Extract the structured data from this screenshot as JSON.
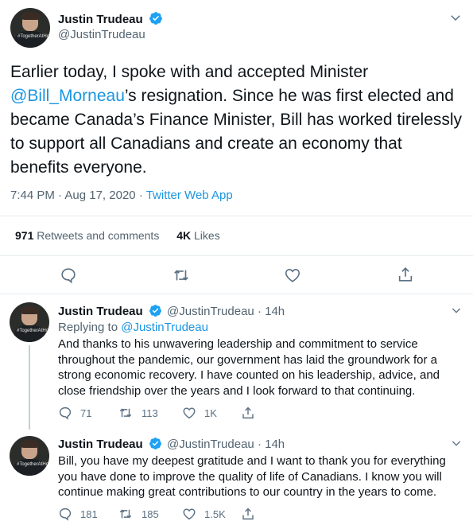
{
  "main_tweet": {
    "author_name": "Justin Trudeau",
    "author_handle": "@JustinTrudeau",
    "avatar_caption": "#TogetherAtHome",
    "text_before": "Earlier today, I spoke with and accepted Minister ",
    "mention": "@Bill_Morneau",
    "text_after": "’s resignation. Since he was first elected and became Canada’s Finance Minister, Bill has worked tirelessly to support all Canadians and create an economy that benefits everyone.",
    "time": "7:44 PM",
    "date": "Aug 17, 2020",
    "separator": "·",
    "source": "Twitter Web App",
    "retweets_count": "971",
    "retweets_label": "Retweets and comments",
    "likes_count": "4K",
    "likes_label": "Likes"
  },
  "replies": [
    {
      "author_name": "Justin Trudeau",
      "author_handle": "@JustinTrudeau",
      "time_ago": "· 14h",
      "replying_to_label": "Replying to",
      "replying_to_handle": "@JustinTrudeau",
      "text": "And thanks to his unwavering leadership and commitment to service throughout the pandemic, our government has laid the groundwork for a strong economic recovery. I have counted on his leadership, advice, and close friendship over the years and I look forward to that continuing.",
      "comments": "71",
      "retweets": "113",
      "likes": "1K"
    },
    {
      "author_name": "Justin Trudeau",
      "author_handle": "@JustinTrudeau",
      "time_ago": "· 14h",
      "text": "Bill, you have my deepest gratitude and I want to thank you for everything you have done to improve the quality of life of Canadians. I know you will continue making great contributions to our country in the years to come.",
      "comments": "181",
      "retweets": "185",
      "likes": "1.5K"
    }
  ],
  "icons": {
    "verified": "verified-badge-icon",
    "more": "chevron-down-icon",
    "reply": "comment-icon",
    "retweet": "retweet-icon",
    "like": "heart-icon",
    "share": "share-icon"
  },
  "colors": {
    "link": "#1b95e0",
    "verified": "#1da1f2",
    "icon_gray": "#5b7083"
  }
}
